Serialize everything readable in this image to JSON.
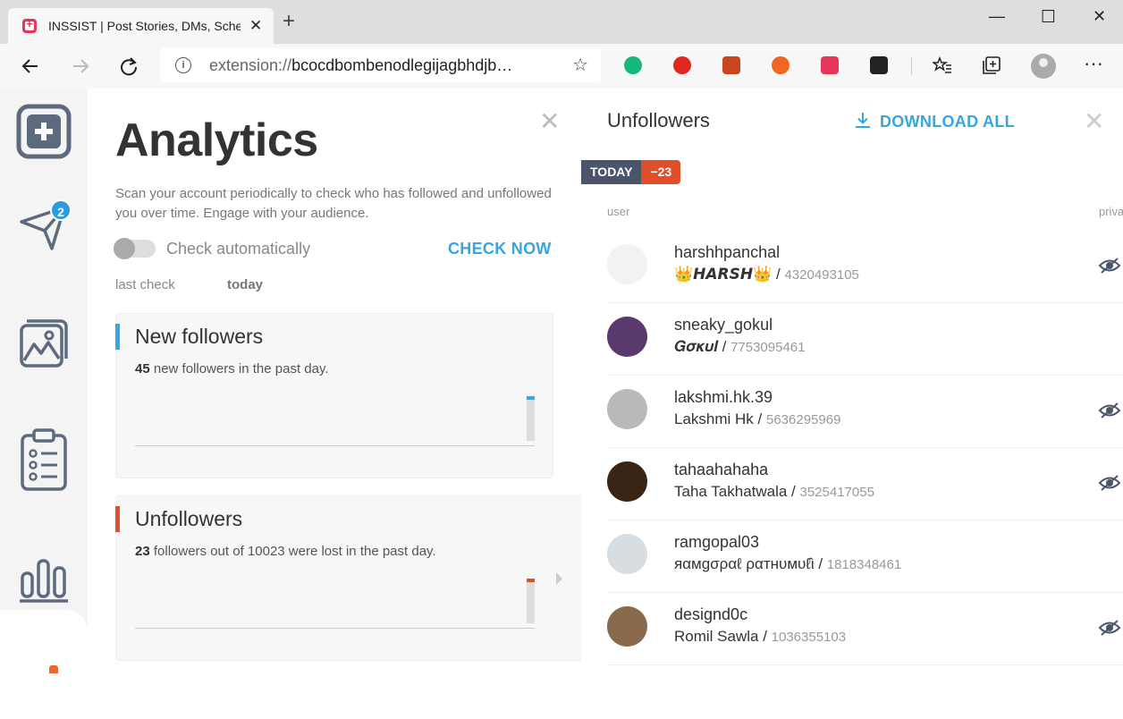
{
  "browser": {
    "tab_title": "INSSIST | Post Stories, DMs, Sche",
    "tab_close": "✕",
    "new_tab": "+",
    "url_text": "extension://",
    "url_rest": "bcocdbombenodlegijagbhdjb…",
    "window_controls": [
      "—",
      "☐",
      "✕"
    ],
    "ext_colors": [
      "#16b87a",
      "#e0271f",
      "#c9461c",
      "#f26522",
      "#e6365b",
      "#222222"
    ]
  },
  "nav": {
    "badge_count": "2"
  },
  "analytics": {
    "title": "Analytics",
    "description": "Scan your account periodically to check who has followed and unfollowed you over time. Engage with your audience.",
    "toggle_label": "Check automatically",
    "check_now": "CHECK NOW",
    "last_check_label": "last check",
    "last_check_value": "today",
    "new_followers": {
      "title": "New followers",
      "count": "45",
      "text": "new followers in the past day.",
      "accent": "#36a5e2",
      "bar_fraction": 1.0
    },
    "unfollowers": {
      "title": "Unfollowers",
      "count": "23",
      "text": "followers out of 10023 were lost in the past day.",
      "accent": "#e04e2a",
      "bar_fraction": 1.0
    }
  },
  "unfollowers_panel": {
    "title": "Unfollowers",
    "download_label": "DOWNLOAD ALL",
    "today_label": "TODAY",
    "today_delta": "−23",
    "col_user": "user",
    "col_private": "priva",
    "rows": [
      {
        "username": "harshhpanchal",
        "fullname": "👑𝙃𝘼𝙍𝙎𝙃👑",
        "id": "4320493105",
        "private": true,
        "avatar": "#f2f2f2"
      },
      {
        "username": "sneaky_gokul",
        "fullname": "𝑮𝝈𝜿𝝊𝒍",
        "id": "7753095461",
        "private": false,
        "avatar": "#5a3a6e"
      },
      {
        "username": "lakshmi.hk.39",
        "fullname": "Lakshmi Hk",
        "id": "5636295969",
        "private": true,
        "avatar": "#b9b9b9"
      },
      {
        "username": "tahaahahaha",
        "fullname": "Taha Takhatwala",
        "id": "3525417055",
        "private": true,
        "avatar": "#3a2414"
      },
      {
        "username": "ramgopal03",
        "fullname": "яαмgσραℓ ραтнυмυℓ̂ι",
        "id": "1818348461",
        "private": false,
        "avatar": "#d8dde2"
      },
      {
        "username": "designd0c",
        "fullname": "Romil Sawla",
        "id": "1036355103",
        "private": true,
        "avatar": "#8a6a4c"
      }
    ]
  }
}
